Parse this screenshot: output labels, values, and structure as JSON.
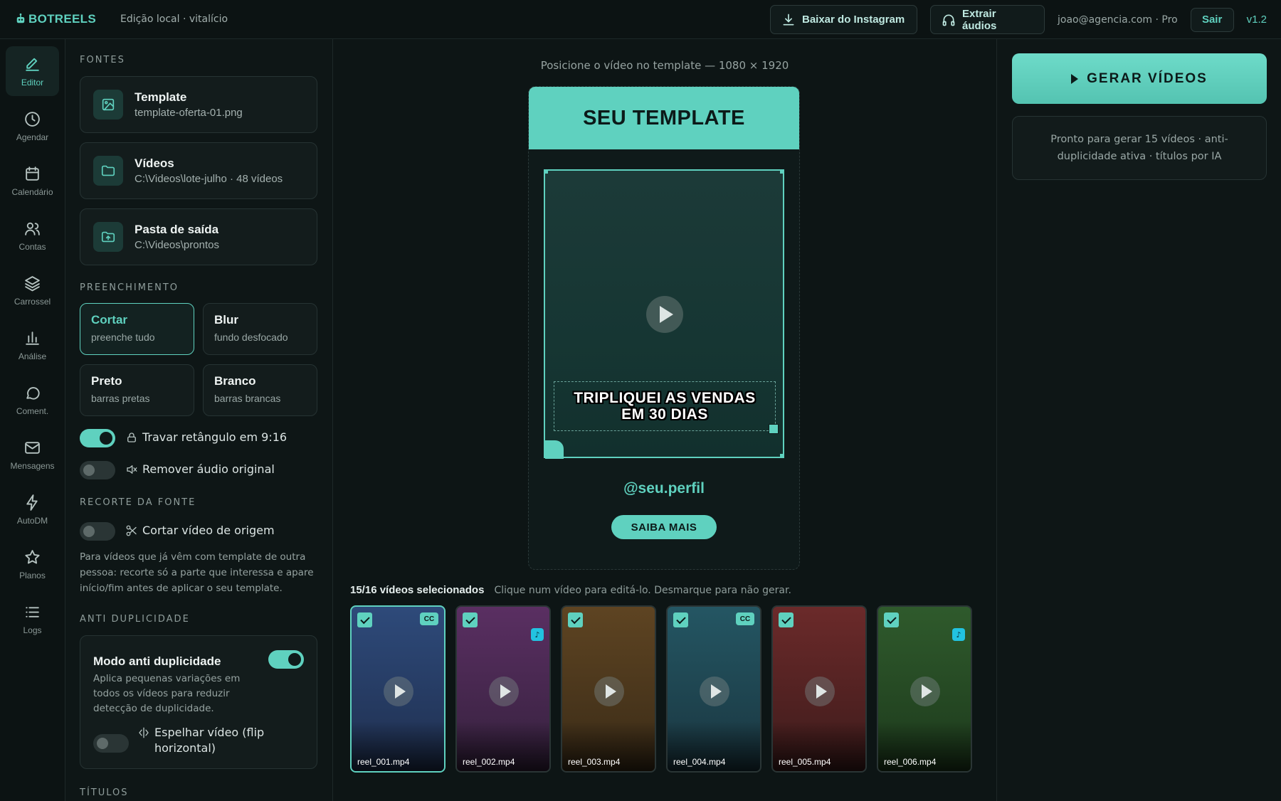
{
  "header": {
    "brand": "BOTREELS",
    "edition": "Edição local · vitalício",
    "btn_instagram": "Baixar do Instagram",
    "btn_audios": "Extrair áudios",
    "user": "joao@agencia.com · Pro",
    "logout": "Sair",
    "version": "v1.2"
  },
  "nav": {
    "items": [
      {
        "label": "Editor",
        "icon": "pencil-icon",
        "active": true
      },
      {
        "label": "Agendar",
        "icon": "clock-icon"
      },
      {
        "label": "Calendário",
        "icon": "calendar-icon"
      },
      {
        "label": "Contas",
        "icon": "users-icon"
      },
      {
        "label": "Carrossel",
        "icon": "layers-icon"
      },
      {
        "label": "Análise",
        "icon": "bar-chart-icon"
      },
      {
        "label": "Coment.",
        "icon": "comment-icon"
      },
      {
        "label": "Mensagens",
        "icon": "mail-icon"
      },
      {
        "label": "AutoDM",
        "icon": "bolt-icon"
      },
      {
        "label": "Planos",
        "icon": "star-icon"
      },
      {
        "label": "Logs",
        "icon": "list-icon"
      }
    ]
  },
  "sources": {
    "heading": "FONTES",
    "template": {
      "title": "Template",
      "value": "template-oferta-01.png"
    },
    "videos": {
      "title": "Vídeos",
      "value": "C:\\Videos\\lote-julho · 48 vídeos"
    },
    "output": {
      "title": "Pasta de saída",
      "value": "C:\\Videos\\prontos"
    }
  },
  "fill": {
    "heading": "PREENCHIMENTO",
    "options": [
      {
        "title": "Cortar",
        "sub": "preenche tudo",
        "selected": true
      },
      {
        "title": "Blur",
        "sub": "fundo desfocado"
      },
      {
        "title": "Preto",
        "sub": "barras pretas"
      },
      {
        "title": "Branco",
        "sub": "barras brancas"
      }
    ]
  },
  "toggles": {
    "lock_ratio": {
      "label": "Travar retângulo em 9:16",
      "on": true
    },
    "remove_audio": {
      "label": "Remover áudio original",
      "on": false
    }
  },
  "crop": {
    "heading": "RECORTE DA FONTE",
    "toggle_label": "Cortar vídeo de origem",
    "note": "Para vídeos que já vêm com template de outra pessoa: recorte só a parte que interessa e apare início/fim antes de aplicar o seu template."
  },
  "anti": {
    "heading": "ANTI DUPLICIDADE",
    "title": "Modo anti duplicidade",
    "desc": "Aplica pequenas variações em todos os vídeos para reduzir detecção de duplicidade.",
    "mirror_label": "Espelhar vídeo (flip horizontal)",
    "on": true,
    "mirror_on": false
  },
  "titles_heading": "TÍTULOS",
  "preview": {
    "label": "Posicione o vídeo no template — 1080 × 1920",
    "template_title": "SEU TEMPLATE",
    "caption_line1": "TRIPLIQUEI AS VENDAS",
    "caption_line2": "EM 30 DIAS",
    "profile": "@seu.perfil",
    "cta": "SAIBA MAIS"
  },
  "selection": {
    "count": "15/16 vídeos selecionados",
    "hint": "Clique num vídeo para editá-lo. Desmarque para não gerar."
  },
  "thumbs": [
    {
      "name": "reel_001.mp4",
      "badge": "CC",
      "colors": [
        "#2e4a7a",
        "#1f2f4f"
      ],
      "current": true
    },
    {
      "name": "reel_002.mp4",
      "badge": "♪",
      "colors": [
        "#5a2f62",
        "#35213d"
      ]
    },
    {
      "name": "reel_003.mp4",
      "badge": "",
      "colors": [
        "#5e4422",
        "#3a2b17"
      ]
    },
    {
      "name": "reel_004.mp4",
      "badge": "CC",
      "colors": [
        "#245663",
        "#1a3640"
      ]
    },
    {
      "name": "reel_005.mp4",
      "badge": "",
      "colors": [
        "#6b2a2a",
        "#3d1b1b"
      ]
    },
    {
      "name": "reel_006.mp4",
      "badge": "♪",
      "colors": [
        "#2f5a2c",
        "#1d3a1c"
      ]
    }
  ],
  "actions": {
    "generate": "GERAR VÍDEOS",
    "status": "Pronto para gerar 15 vídeos · anti-duplicidade ativa · títulos por IA"
  }
}
